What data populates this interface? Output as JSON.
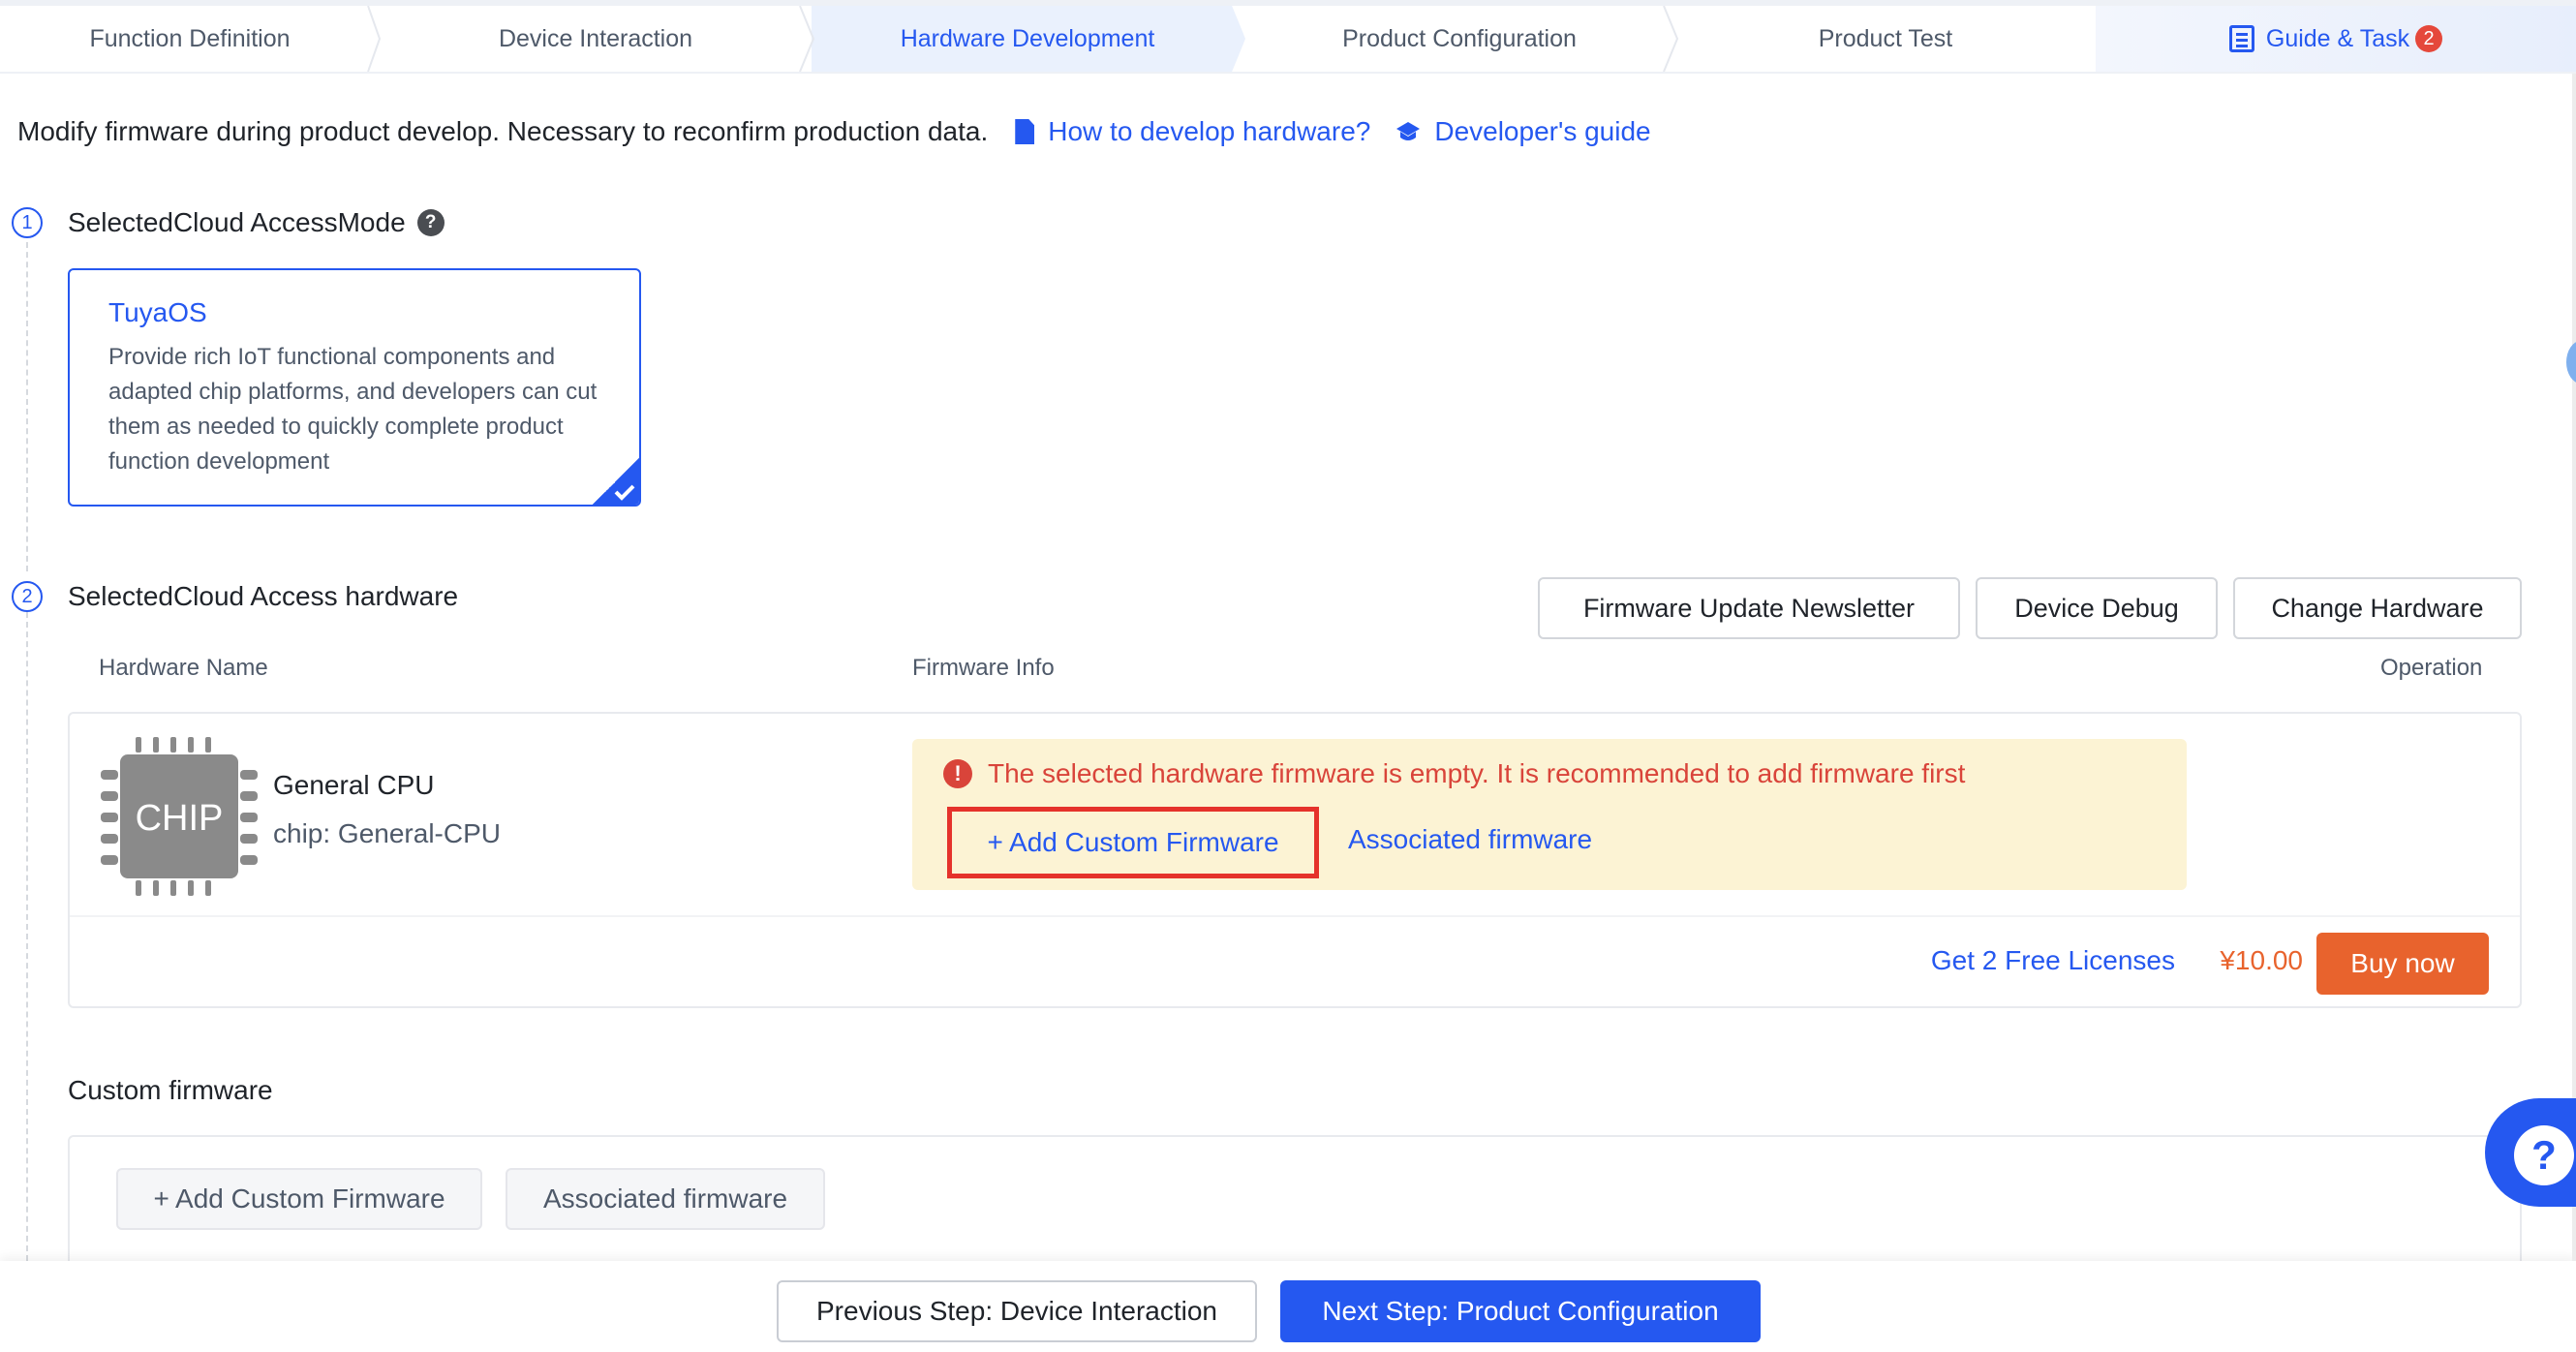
{
  "steps": [
    {
      "label": "Function Definition",
      "active": false
    },
    {
      "label": "Device Interaction",
      "active": false
    },
    {
      "label": "Hardware Development",
      "active": true
    },
    {
      "label": "Product Configuration",
      "active": false
    },
    {
      "label": "Product Test",
      "active": false
    }
  ],
  "guide": {
    "label": "Guide & Task",
    "badge": "2",
    "icon": "list-icon"
  },
  "intro": {
    "text": "Modify firmware during product develop. Necessary to reconfirm production data.",
    "links": [
      {
        "label": "How to develop hardware?",
        "icon": "document-icon"
      },
      {
        "label": "Developer's guide",
        "icon": "graduation-cap-icon"
      }
    ]
  },
  "section1": {
    "number": "1",
    "title": "SelectedCloud AccessMode",
    "help_icon": "?",
    "card": {
      "title": "TuyaOS",
      "description": "Provide rich IoT functional components and adapted chip platforms, and developers can cut them as needed to quickly complete product function development",
      "selected": true
    }
  },
  "section2": {
    "number": "2",
    "title": "SelectedCloud Access hardware",
    "buttons": [
      "Firmware Update Newsletter",
      "Device Debug",
      "Change Hardware"
    ],
    "columns": [
      "Hardware Name",
      "Firmware Info",
      "Operation"
    ],
    "hardware": {
      "chip_label": "CHIP",
      "name": "General CPU",
      "chip": "chip: General-CPU",
      "warning": "The selected hardware firmware is empty. It is recommended to add firmware first",
      "add_button": "+ Add Custom Firmware",
      "associated_link": "Associated firmware",
      "licenses_link": "Get 2 Free Licenses",
      "price": "¥10.00",
      "buy_button": "Buy now"
    }
  },
  "custom_firmware": {
    "title": "Custom firmware",
    "add_button": "+ Add Custom Firmware",
    "associated_button": "Associated firmware"
  },
  "footer": {
    "prev": "Previous Step: Device Interaction",
    "next": "Next Step: Product Configuration"
  },
  "help_fab": "?",
  "colors": {
    "primary": "#2558f0",
    "warning_text": "#d9443a",
    "warning_bg": "#fcf3d4",
    "price": "#e8632d",
    "highlight_border": "#e5322b"
  }
}
